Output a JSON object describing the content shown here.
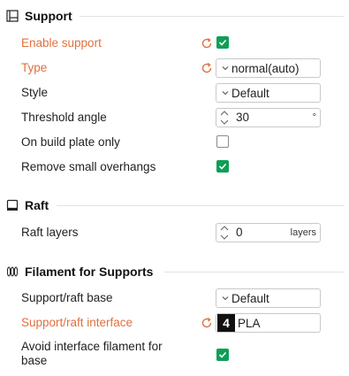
{
  "sections": {
    "support": {
      "title": "Support",
      "icon": "support-icon"
    },
    "raft": {
      "title": "Raft",
      "icon": "raft-icon"
    },
    "filament": {
      "title": "Filament for Supports",
      "icon": "filament-icon"
    }
  },
  "support": {
    "enable_support": {
      "label": "Enable support",
      "checked": true,
      "modified": true
    },
    "type": {
      "label": "Type",
      "value": "normal(auto)",
      "modified": true
    },
    "style": {
      "label": "Style",
      "value": "Default"
    },
    "threshold_angle": {
      "label": "Threshold angle",
      "value": "30",
      "unit": "°"
    },
    "on_build_plate_only": {
      "label": "On build plate only",
      "checked": false
    },
    "remove_small_overhangs": {
      "label": "Remove small overhangs",
      "checked": true
    }
  },
  "raft": {
    "raft_layers": {
      "label": "Raft layers",
      "value": "0",
      "unit": "layers"
    }
  },
  "filament": {
    "support_raft_base": {
      "label": "Support/raft base",
      "value": "Default"
    },
    "support_raft_interface": {
      "label": "Support/raft interface",
      "badge": "4",
      "value": "PLA",
      "modified": true
    },
    "avoid_interface": {
      "label": "Avoid interface filament for base",
      "checked": true
    }
  },
  "colors": {
    "modified_label": "#e0703f",
    "check_green": "#0f9e57",
    "reset_icon": "#e0703f"
  }
}
